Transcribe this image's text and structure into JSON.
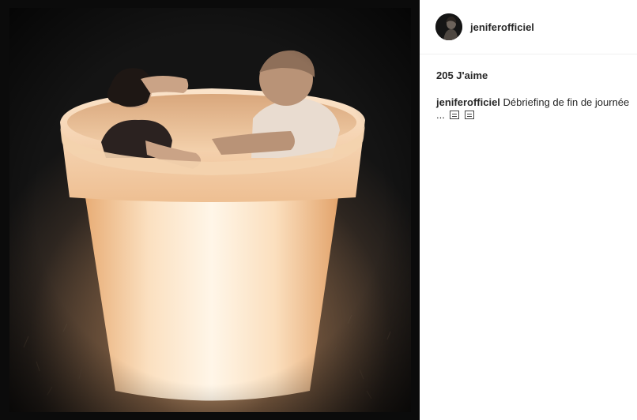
{
  "post": {
    "account": {
      "username": "jeniferofficiel",
      "avatar_icon": "profile-photo"
    },
    "likes_text": "205 J'aime",
    "caption": {
      "username": "jeniferofficiel",
      "text": "Débriefing de fin de journée ...",
      "emojis": [
        "unrendered-emoji-glyph",
        "unrendered-emoji-glyph"
      ]
    },
    "photo": {
      "subject": "photo",
      "palette": {
        "frame": "#0b0b0b",
        "glow_center": "#fff4e2",
        "glow_mid": "#f2c89a",
        "glow_edge": "#c98a55",
        "ground": "#3a2f25",
        "night": "#1c1c1c"
      }
    }
  },
  "colors": {
    "text": "#262626",
    "divider": "#efefef",
    "background": "#ffffff"
  }
}
